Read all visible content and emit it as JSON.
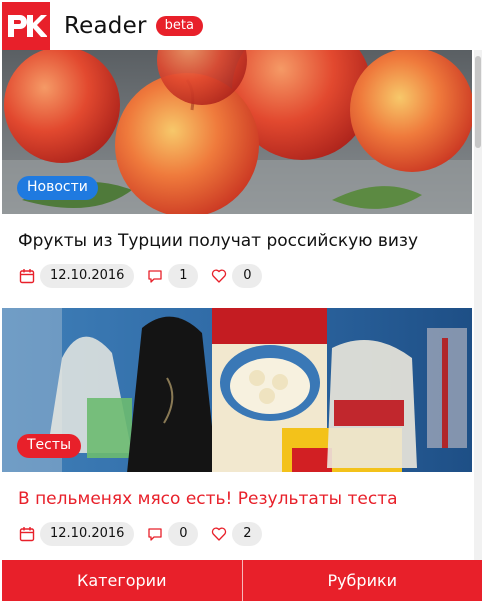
{
  "header": {
    "logo_text": "РК",
    "title": "Reader",
    "badge": "beta"
  },
  "articles": [
    {
      "category": "Новости",
      "title": "Фрукты из Турции получат российскую визу",
      "date": "12.10.2016",
      "comments": "1",
      "likes": "0"
    },
    {
      "category": "Тесты",
      "title": "В пельменях мясо есть! Результаты теста",
      "date": "12.10.2016",
      "comments": "0",
      "likes": "2"
    }
  ],
  "bottom_nav": {
    "categories_label": "Категории",
    "rubrics_label": "Рубрики"
  },
  "colors": {
    "accent": "#e8202a",
    "news_tag": "#1f7ae0",
    "pill_bg": "#ececec"
  },
  "icons": [
    "calendar-icon",
    "comment-icon",
    "heart-icon"
  ]
}
